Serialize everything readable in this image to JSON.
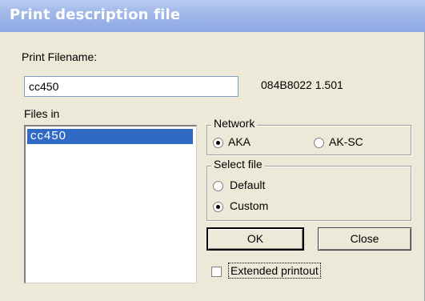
{
  "window": {
    "title": "Print description file"
  },
  "print_filename": {
    "label": "Print Filename:",
    "value": "cc450"
  },
  "version_text": "084B8022 1.501",
  "files": {
    "label": "Files in",
    "items": [
      "cc450"
    ]
  },
  "network": {
    "label": "Network",
    "options": [
      {
        "label": "AKA",
        "checked": true
      },
      {
        "label": "AK-SC",
        "checked": false
      }
    ]
  },
  "select_file": {
    "label": "Select file",
    "options": [
      {
        "label": "Default",
        "checked": false
      },
      {
        "label": "Custom",
        "checked": true
      }
    ]
  },
  "buttons": {
    "ok": "OK",
    "close": "Close"
  },
  "extended_printout": {
    "label": "Extended printout",
    "checked": false
  },
  "colors": {
    "title_bar": "#9fb7e8",
    "selection": "#316ac5",
    "dialog_bg": "#ece9d8"
  }
}
